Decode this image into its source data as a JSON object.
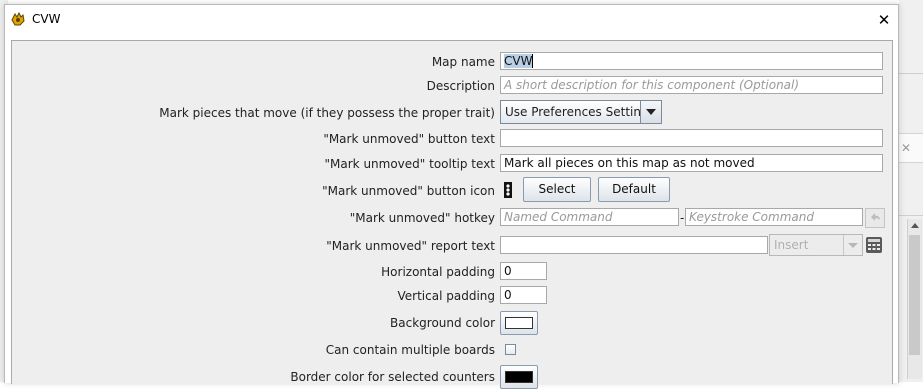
{
  "window": {
    "title": "CVW",
    "close_glyph": "✕",
    "app_icon": "vassal-app-icon"
  },
  "form": {
    "map_name": {
      "label": "Map name",
      "value": "CVW"
    },
    "description": {
      "label": "Description",
      "placeholder": "A short description for this component (Optional)"
    },
    "mark_pieces": {
      "label": "Mark pieces that move (if they possess the proper trait)",
      "value": "Use Preferences Setting"
    },
    "mark_button_text": {
      "label": "\"Mark unmoved\" button text",
      "value": ""
    },
    "mark_tooltip": {
      "label": "\"Mark unmoved\" tooltip text",
      "value": "Mark all pieces on this map as not moved"
    },
    "mark_icon": {
      "label": "\"Mark unmoved\" button icon",
      "select": "Select",
      "default": "Default"
    },
    "mark_hotkey": {
      "label": "\"Mark unmoved\" hotkey",
      "named_placeholder": "Named Command",
      "separator": "-",
      "keystroke_placeholder": "Keystroke Command"
    },
    "mark_report": {
      "label": "\"Mark unmoved\" report text",
      "value": "",
      "insert": "Insert"
    },
    "h_padding": {
      "label": "Horizontal padding",
      "value": "0"
    },
    "v_padding": {
      "label": "Vertical padding",
      "value": "0"
    },
    "bg_color": {
      "label": "Background color",
      "color": "#ffffff"
    },
    "multi_boards": {
      "label": "Can contain multiple boards",
      "checked": false
    },
    "border_color": {
      "label": "Border color for selected counters",
      "color": "#000000"
    }
  }
}
